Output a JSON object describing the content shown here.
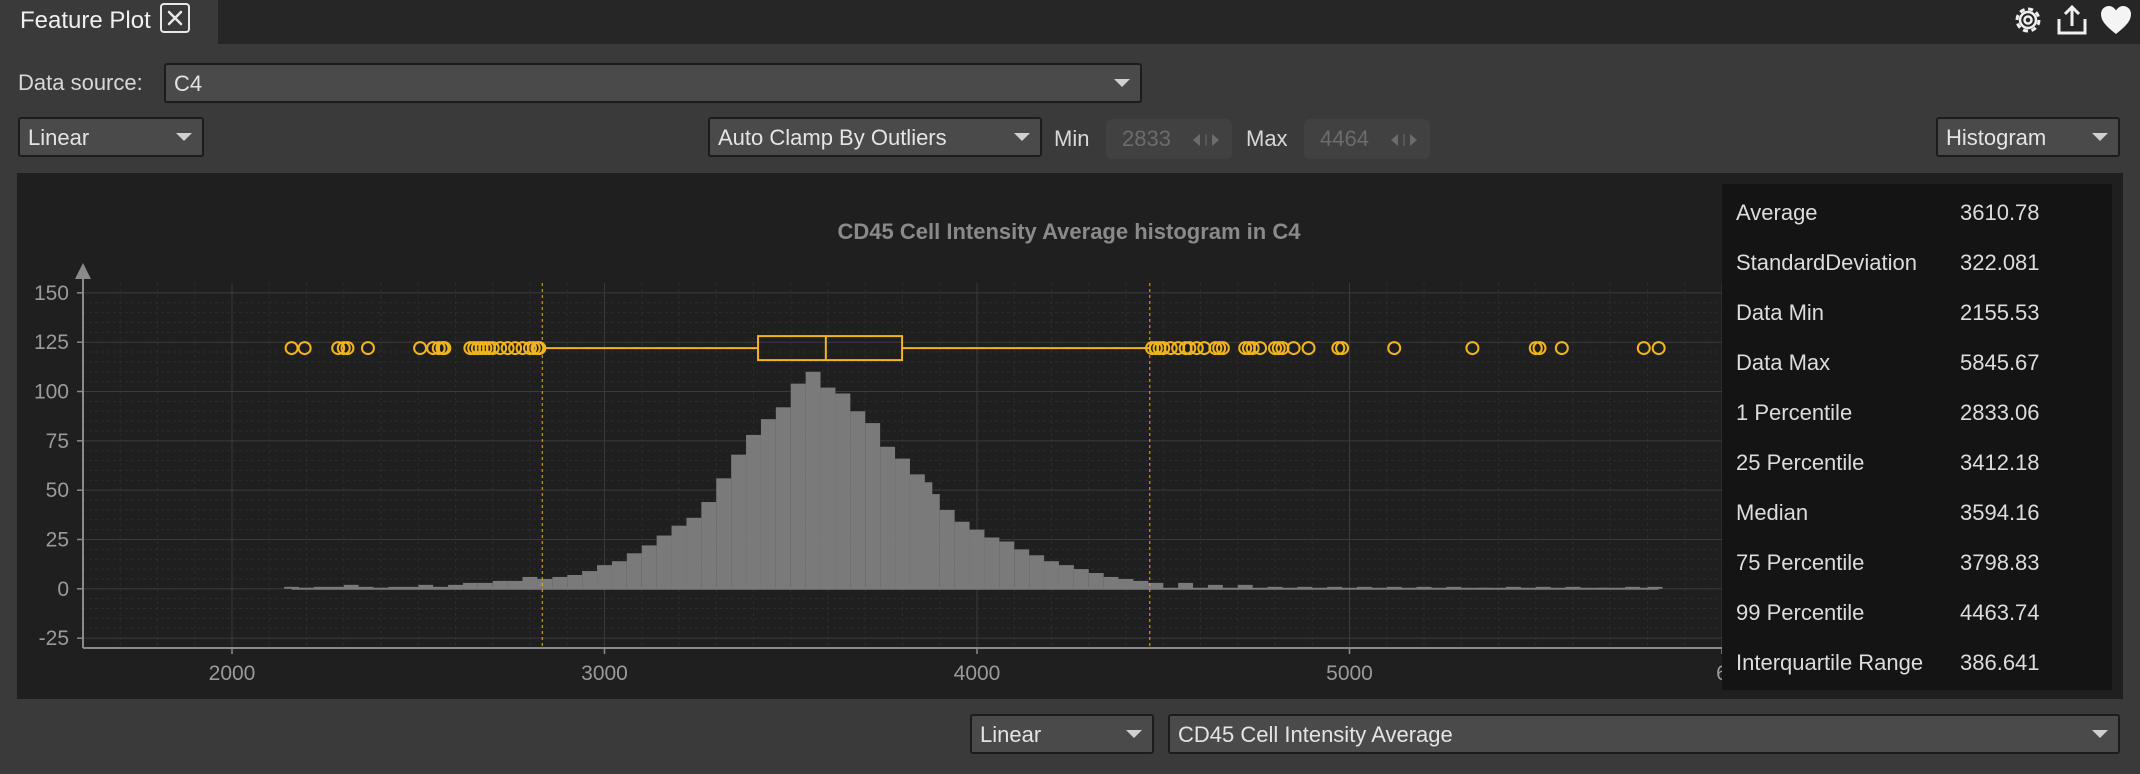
{
  "tab": {
    "title": "Feature Plot"
  },
  "toolbar_icons": [
    "gear-icon",
    "export-icon",
    "heart-icon"
  ],
  "data_source": {
    "label": "Data source:",
    "value": "C4"
  },
  "controls": {
    "y_scale": "Linear",
    "clamp_mode": "Auto Clamp By Outliers",
    "min_label": "Min",
    "min_value": "2833",
    "max_label": "Max",
    "max_value": "4464",
    "plot_type": "Histogram"
  },
  "bottom": {
    "x_scale": "Linear",
    "feature": "CD45 Cell Intensity Average"
  },
  "stats": [
    {
      "name": "Average",
      "value": "3610.78"
    },
    {
      "name": "StandardDeviation",
      "value": "322.081"
    },
    {
      "name": "Data Min",
      "value": "2155.53"
    },
    {
      "name": "Data Max",
      "value": "5845.67"
    },
    {
      "name": "1 Percentile",
      "value": "2833.06"
    },
    {
      "name": "25 Percentile",
      "value": "3412.18"
    },
    {
      "name": "Median",
      "value": "3594.16"
    },
    {
      "name": "75 Percentile",
      "value": "3798.83"
    },
    {
      "name": "99 Percentile",
      "value": "4463.74"
    },
    {
      "name": "Interquartile Range",
      "value": "386.641"
    }
  ],
  "colors": {
    "accent": "#f2b51c",
    "bars": "#7a7a7a",
    "panel": "#1f1f1f",
    "background": "#3a3a3a"
  },
  "chart_data": {
    "type": "bar",
    "title": "CD45 Cell Intensity Average histogram in C4",
    "xlabel": "",
    "ylabel": "",
    "xlim": [
      1600,
      6000
    ],
    "ylim": [
      -30,
      155
    ],
    "xticks": [
      2000,
      3000,
      4000,
      5000,
      6000
    ],
    "xtick_labels": [
      "2000",
      "3000",
      "4000",
      "5000",
      "6"
    ],
    "yticks": [
      -25,
      0,
      25,
      50,
      75,
      100,
      125,
      150
    ],
    "bin_width": 20,
    "x": [
      2160,
      2200,
      2240,
      2280,
      2320,
      2360,
      2400,
      2440,
      2480,
      2520,
      2560,
      2600,
      2640,
      2680,
      2720,
      2760,
      2800,
      2840,
      2880,
      2920,
      2960,
      3000,
      3040,
      3080,
      3120,
      3160,
      3200,
      3240,
      3280,
      3320,
      3360,
      3400,
      3440,
      3480,
      3520,
      3560,
      3600,
      3640,
      3680,
      3720,
      3760,
      3800,
      3840,
      3860,
      3880,
      3920,
      3960,
      4000,
      4040,
      4080,
      4120,
      4160,
      4200,
      4240,
      4280,
      4320,
      4360,
      4400,
      4440,
      4480,
      4560,
      4640,
      4720,
      4800,
      4880,
      4960,
      5040,
      5120,
      5200,
      5280,
      5360,
      5440,
      5520,
      5600,
      5680,
      5760,
      5820
    ],
    "values": [
      1,
      0,
      1,
      1,
      2,
      1,
      0,
      1,
      1,
      2,
      1,
      2,
      3,
      3,
      4,
      4,
      6,
      5,
      6,
      7,
      9,
      12,
      14,
      18,
      22,
      27,
      32,
      36,
      44,
      56,
      68,
      78,
      86,
      92,
      104,
      110,
      102,
      99,
      90,
      84,
      72,
      66,
      58,
      54,
      48,
      40,
      34,
      30,
      26,
      24,
      20,
      17,
      14,
      12,
      10,
      8,
      6,
      5,
      4,
      3,
      3,
      2,
      2,
      1,
      1,
      1,
      1,
      1,
      1,
      1,
      0,
      1,
      1,
      1,
      0,
      1,
      1
    ],
    "boxplot": {
      "y": 122,
      "q1": 3412.18,
      "median": 3594.16,
      "q3": 3798.83,
      "whisker_low": 2833.06,
      "whisker_high": 4463.74
    },
    "outliers": [
      2160,
      2195,
      2285,
      2300,
      2310,
      2365,
      2505,
      2540,
      2555,
      2565,
      2570,
      2640,
      2650,
      2660,
      2670,
      2680,
      2690,
      2700,
      2720,
      2740,
      2760,
      2780,
      2800,
      2810,
      2820,
      2825,
      4470,
      4480,
      4490,
      4500,
      4520,
      4540,
      4560,
      4570,
      4590,
      4610,
      4640,
      4650,
      4660,
      4720,
      4730,
      4740,
      4760,
      4800,
      4810,
      4820,
      4850,
      4890,
      4970,
      4980,
      5120,
      5330,
      5500,
      5510,
      5570,
      5790,
      5830
    ],
    "reference_lines": [
      2833.06,
      4463.74
    ],
    "grid": true
  }
}
